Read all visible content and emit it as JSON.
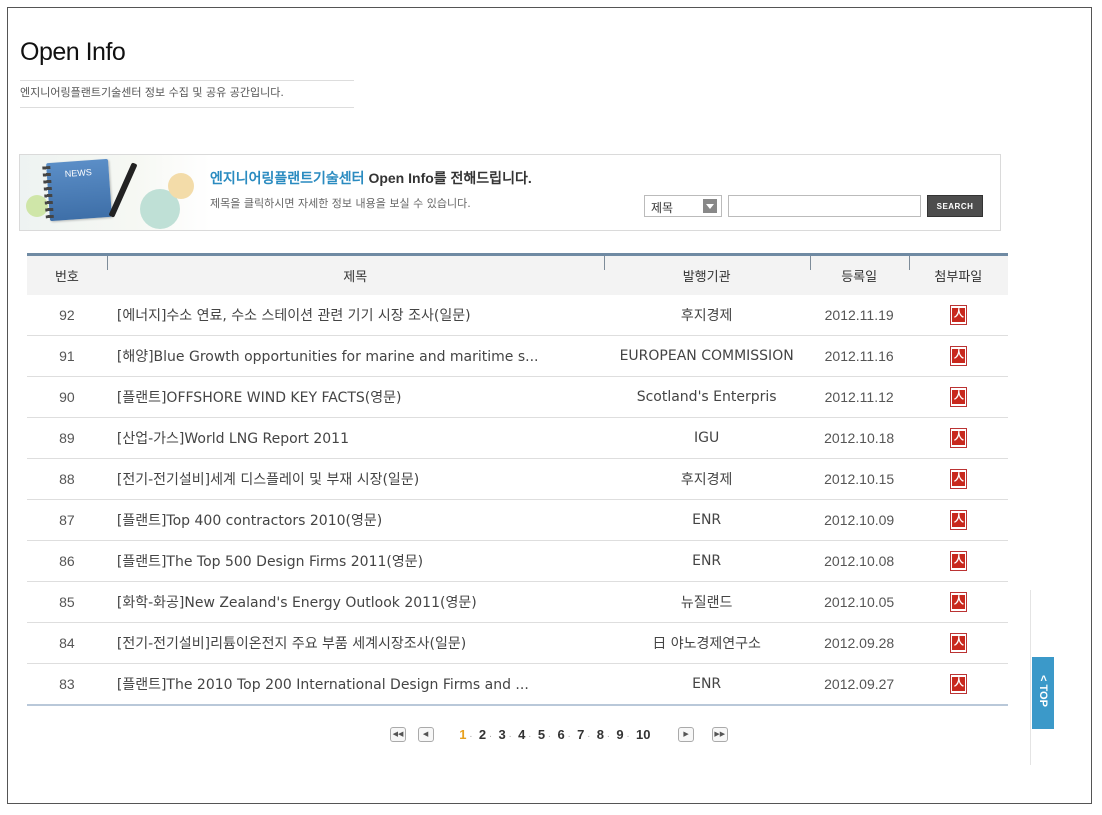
{
  "page": {
    "title": "Open Info",
    "subtitle": "엔지니어링플랜트기술센터 정보 수집 및 공유 공간입니다."
  },
  "banner": {
    "badge": "NEWS",
    "heading_brand": "엔지니어링플랜트기술센터",
    "heading_rest": " Open Info를 전해드립니다.",
    "description": "제목을 클릭하시면 자세한 정보 내용을 보실 수 있습니다."
  },
  "search": {
    "select_value": "제목",
    "input_value": "",
    "button_label": "SEARCH"
  },
  "table": {
    "headers": [
      "번호",
      "제목",
      "발행기관",
      "등록일",
      "첨부파일"
    ],
    "rows": [
      {
        "num": "92",
        "title": "[에너지]수소 연료, 수소 스테이션 관련 기기 시장 조사(일문)",
        "org": "후지경제",
        "date": "2012.11.19",
        "file": "pdf-icon"
      },
      {
        "num": "91",
        "title": "[해양]Blue Growth opportunities for marine and maritime s...",
        "org": "EUROPEAN COMMISSION",
        "date": "2012.11.16",
        "file": "pdf-icon"
      },
      {
        "num": "90",
        "title": "[플랜트]OFFSHORE WIND KEY FACTS(영문)",
        "org": "Scotland's Enterpris",
        "date": "2012.11.12",
        "file": "pdf-icon"
      },
      {
        "num": "89",
        "title": "[산업-가스]World LNG Report 2011",
        "org": "IGU",
        "date": "2012.10.18",
        "file": "pdf-icon"
      },
      {
        "num": "88",
        "title": "[전기-전기설비]세계 디스플레이 및 부재 시장(일문)",
        "org": "후지경제",
        "date": "2012.10.15",
        "file": "pdf-icon"
      },
      {
        "num": "87",
        "title": "[플랜트]Top 400 contractors 2010(영문)",
        "org": "ENR",
        "date": "2012.10.09",
        "file": "pdf-icon"
      },
      {
        "num": "86",
        "title": "[플랜트]The Top 500 Design Firms 2011(영문)",
        "org": "ENR",
        "date": "2012.10.08",
        "file": "pdf-icon"
      },
      {
        "num": "85",
        "title": "[화학-화공]New Zealand's Energy Outlook 2011(영문)",
        "org": "뉴질랜드",
        "date": "2012.10.05",
        "file": "pdf-icon"
      },
      {
        "num": "84",
        "title": "[전기-전기설비]리튬이온전지 주요 부품 세계시장조사(일문)",
        "org": "日 야노경제연구소",
        "date": "2012.09.28",
        "file": "pdf-icon"
      },
      {
        "num": "83",
        "title": "[플랜트]The 2010 Top 200 International Design Firms and ...",
        "org": "ENR",
        "date": "2012.09.27",
        "file": "pdf-icon"
      }
    ]
  },
  "pagination": {
    "first": "◀◀",
    "prev": "◀",
    "next": "▶",
    "last": "▶▶",
    "pages": [
      "1",
      "2",
      "3",
      "4",
      "5",
      "6",
      "7",
      "8",
      "9",
      "10"
    ],
    "current": "1"
  },
  "top_button": {
    "label": "TOP",
    "icon": "chevron-up-icon"
  },
  "colors": {
    "accent": "#2a8bc0",
    "current_page": "#e7a01d",
    "top_button": "#3b99c9",
    "pdf": "#c8281d"
  }
}
